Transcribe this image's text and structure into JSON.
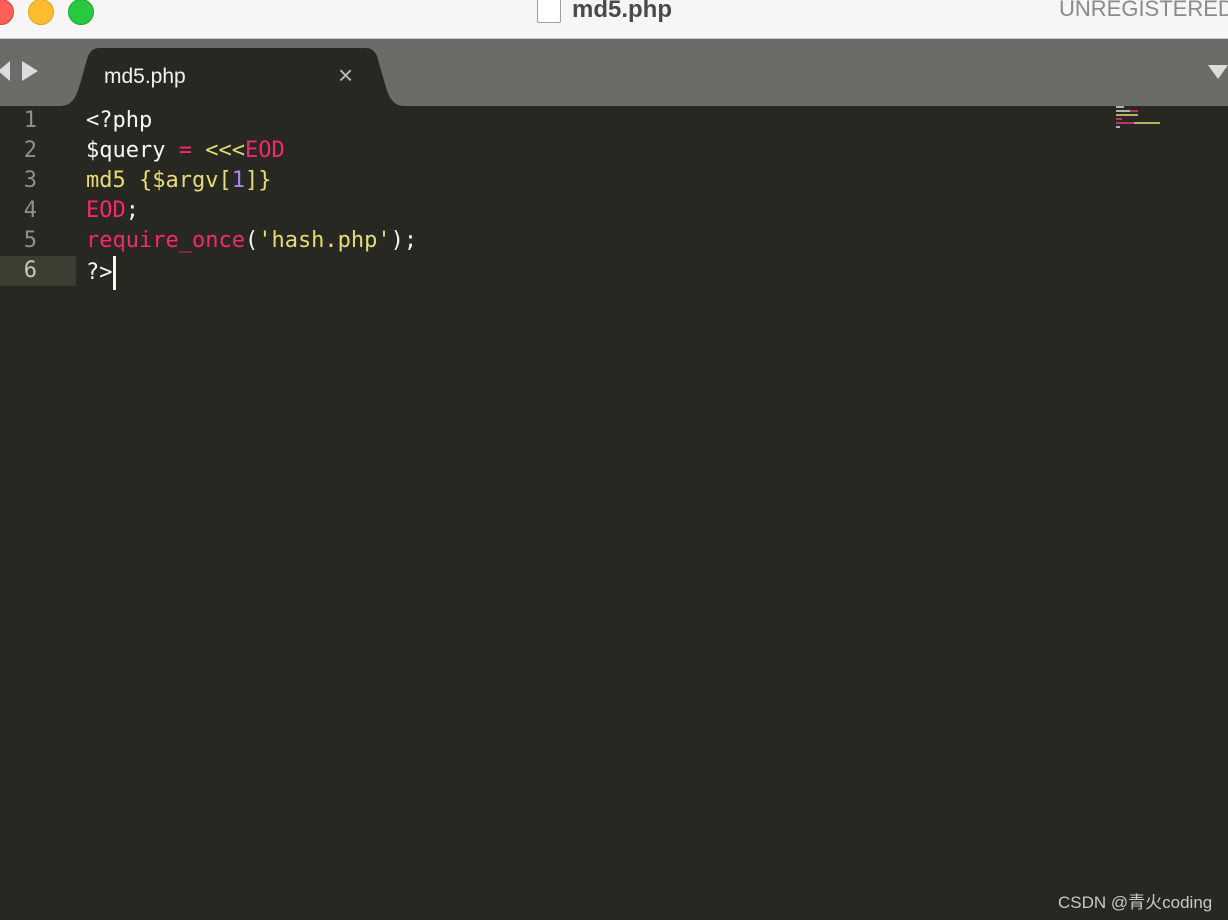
{
  "window": {
    "title": "md5.php",
    "license_status": "UNREGISTERED"
  },
  "tabs": [
    {
      "label": "md5.php",
      "close_symbol": "×",
      "active": true
    }
  ],
  "editor": {
    "line_numbers": [
      "1",
      "2",
      "3",
      "4",
      "5",
      "6"
    ],
    "active_line": 6,
    "lines": [
      [
        {
          "text": "<?php",
          "kind": "plain"
        }
      ],
      [
        {
          "text": "$query ",
          "kind": "plain"
        },
        {
          "text": "=",
          "kind": "kw"
        },
        {
          "text": " ",
          "kind": "plain"
        },
        {
          "text": "<<<",
          "kind": "str"
        },
        {
          "text": "EOD",
          "kind": "kw"
        }
      ],
      [
        {
          "text": "md5 {$argv[",
          "kind": "str"
        },
        {
          "text": "1",
          "kind": "num"
        },
        {
          "text": "]}",
          "kind": "str"
        }
      ],
      [
        {
          "text": "EOD",
          "kind": "kw"
        },
        {
          "text": ";",
          "kind": "plain"
        }
      ],
      [
        {
          "text": "require_once",
          "kind": "kw"
        },
        {
          "text": "(",
          "kind": "plain"
        },
        {
          "text": "'hash.php'",
          "kind": "str"
        },
        {
          "text": ");",
          "kind": "plain"
        }
      ],
      [
        {
          "text": "?>",
          "kind": "plain"
        }
      ]
    ]
  },
  "colors": {
    "background": "#272822",
    "keyword": "#f92672",
    "string": "#e6db74",
    "number": "#ae81ff",
    "plain": "#f8f8f2"
  },
  "icons": {
    "traffic_lights": [
      "close-light-icon",
      "minimize-light-icon",
      "zoom-light-icon"
    ],
    "document": "document-icon",
    "nav": [
      "nav-back-icon",
      "nav-forward-icon"
    ],
    "tab_dropdown": "tab-dropdown-icon"
  },
  "watermark": "CSDN @青火coding"
}
